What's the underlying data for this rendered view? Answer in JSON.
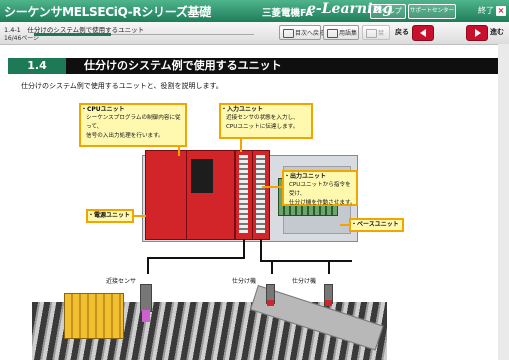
{
  "header": {
    "title": "シーケンサMELSECiQ-Rシリーズ基礎",
    "brand": "三菱電機FA",
    "elearning": "e-Learning",
    "help_label": "ヘルプ",
    "support_label": "サポートセンター",
    "exit_label": "終了"
  },
  "nav": {
    "breadcrumb": "1.4-1　仕分けのシステム例で使用するユニット",
    "page_no": "16/46ページ",
    "progress": 0.35,
    "toc_label": "目次へ戻る",
    "glossary_label": "用語集",
    "bookmark_label": "栞",
    "back_label": "戻る",
    "next_label": "進む"
  },
  "section": {
    "number": "1.4",
    "title": "仕分けのシステム例で使用するユニット",
    "intro": "仕分けのシステム例で使用するユニットと、役割を説明します。"
  },
  "callouts": {
    "cpu": {
      "label": "・CPUユニット",
      "text1": "シーケンスプログラムの制御内容に従って、",
      "text2": "信号の入出力処理を行います。"
    },
    "input": {
      "label": "・入力ユニット",
      "text1": "近接センサの状態を入力し、",
      "text2": "CPUユニットに伝達します。"
    },
    "output": {
      "label": "・出力ユニット",
      "text1": "CPUユニットから指令を受け、",
      "text2": "仕分け機を作動させます。"
    },
    "power": {
      "label": "・電源ユニット"
    },
    "base": {
      "label": "・ベースユニット"
    }
  },
  "plc_labels": [
    "近接センサ",
    "仕分け機",
    "仕分け機"
  ],
  "colors": {
    "header_green": "#1f7d5a",
    "callout_fill": "#fff9b0",
    "callout_border": "#f2a400",
    "module_red": "#d2252a"
  }
}
